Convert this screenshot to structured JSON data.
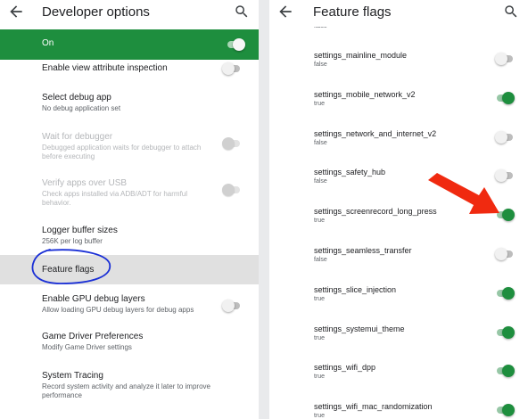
{
  "left": {
    "title": "Developer options",
    "master": {
      "label": "On",
      "state": "on"
    },
    "items": [
      {
        "title": "Enable view attribute inspection",
        "subtitle": "",
        "toggle": "off",
        "enabled": true
      },
      {
        "title": "Select debug app",
        "subtitle": "No debug application set",
        "toggle": null,
        "enabled": true
      },
      {
        "title": "Wait for debugger",
        "subtitle": "Debugged application waits for debugger to attach before executing",
        "toggle": "off",
        "enabled": false
      },
      {
        "title": "Verify apps over USB",
        "subtitle": "Check apps installed via ADB/ADT for harmful behavior.",
        "toggle": "off",
        "enabled": false
      },
      {
        "title": "Logger buffer sizes",
        "subtitle": "256K per log buffer",
        "toggle": null,
        "enabled": true
      },
      {
        "title": "Feature flags",
        "subtitle": "",
        "toggle": null,
        "enabled": true,
        "highlighted": true
      },
      {
        "title": "Enable GPU debug layers",
        "subtitle": "Allow loading GPU debug layers for debug apps",
        "toggle": "off",
        "enabled": true
      },
      {
        "title": "Game Driver Preferences",
        "subtitle": "Modify Game Driver settings",
        "toggle": null,
        "enabled": true
      },
      {
        "title": "System Tracing",
        "subtitle": "Record system activity and analyze it later to improve performance",
        "toggle": null,
        "enabled": true
      }
    ]
  },
  "right": {
    "title": "Feature flags",
    "partial_top_value": "false",
    "flags": [
      {
        "name": "settings_mainline_module",
        "value": "false"
      },
      {
        "name": "settings_mobile_network_v2",
        "value": "true"
      },
      {
        "name": "settings_network_and_internet_v2",
        "value": "false"
      },
      {
        "name": "settings_safety_hub",
        "value": "false"
      },
      {
        "name": "settings_screenrecord_long_press",
        "value": "true"
      },
      {
        "name": "settings_seamless_transfer",
        "value": "false"
      },
      {
        "name": "settings_slice_injection",
        "value": "true"
      },
      {
        "name": "settings_systemui_theme",
        "value": "true"
      },
      {
        "name": "settings_wifi_dpp",
        "value": "true"
      },
      {
        "name": "settings_wifi_mac_randomization",
        "value": "true"
      }
    ]
  },
  "annotations": {
    "circle_target": "Feature flags",
    "arrow_target": "settings_screenrecord_long_press",
    "circle_color": "#1a2fd6",
    "arrow_color": "#f02a10"
  },
  "colors": {
    "accent": "#1e8e3e",
    "highlight_row": "#e0e0e0"
  },
  "icons": {
    "back": "arrow-back-icon",
    "search": "search-icon"
  }
}
